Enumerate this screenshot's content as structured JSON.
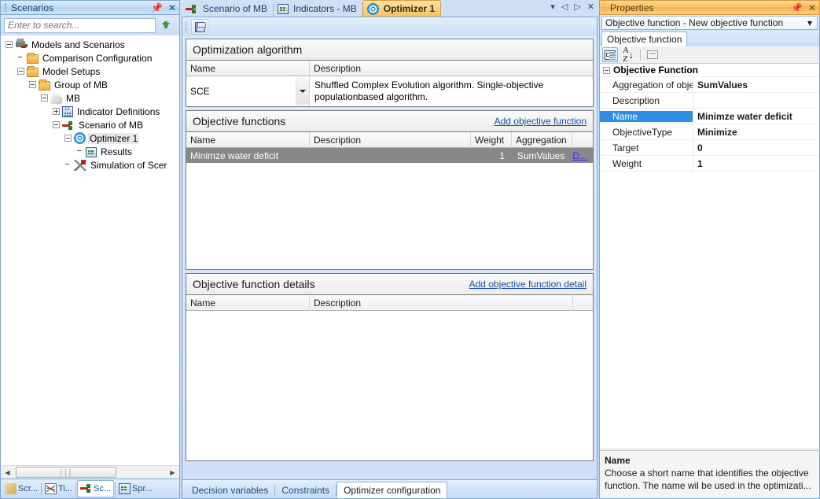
{
  "scenarios": {
    "title": "Scenarios",
    "pin_icon": "pin-icon",
    "close_icon": "close-icon",
    "search": {
      "placeholder": "Enter to search...",
      "value": "",
      "go_icon": "green-down-arrow-icon"
    },
    "tree": [
      {
        "label": "Models and Scenarios",
        "icon": "database-scenario-icon",
        "depth": 0,
        "expander": "minus",
        "selected": false
      },
      {
        "label": "Comparison Configuration",
        "icon": "folder-icon",
        "depth": 1,
        "expander": "none",
        "selected": false
      },
      {
        "label": "Model Setups",
        "icon": "folder-icon",
        "depth": 1,
        "expander": "minus",
        "selected": false
      },
      {
        "label": "Group of MB",
        "icon": "folder-icon",
        "depth": 2,
        "expander": "minus",
        "selected": false
      },
      {
        "label": "MB",
        "icon": "cube-icon",
        "depth": 3,
        "expander": "minus",
        "selected": false
      },
      {
        "label": "Indicator Definitions",
        "icon": "calculator-icon",
        "depth": 4,
        "expander": "plus",
        "selected": false
      },
      {
        "label": "Scenario of MB",
        "icon": "scenario-icon",
        "depth": 4,
        "expander": "minus",
        "selected": false
      },
      {
        "label": "Optimizer 1",
        "icon": "optimizer-icon",
        "depth": 5,
        "expander": "minus",
        "selected": true
      },
      {
        "label": "Results",
        "icon": "results-grid-icon",
        "depth": 6,
        "expander": "none",
        "selected": false
      },
      {
        "label": "Simulation of Scer",
        "icon": "simulation-icon",
        "depth": 5,
        "expander": "none",
        "selected": false
      }
    ],
    "hscroll": {
      "left_arrow": "left-arrow-icon",
      "right_arrow": "right-arrow-icon",
      "thumb_grip": "||||"
    }
  },
  "bottom_left_tabs": [
    {
      "label": "Scr...",
      "icon": "scroll-icon",
      "active": false
    },
    {
      "label": "Ti...",
      "icon": "timeseries-chart-icon",
      "active": false
    },
    {
      "label": "Sc...",
      "icon": "scenario-icon",
      "active": true
    },
    {
      "label": "Spr...",
      "icon": "spreadsheet-icon",
      "active": false
    }
  ],
  "document": {
    "tabs": [
      {
        "label": "Scenario of MB",
        "icon": "scenario-icon",
        "active": false
      },
      {
        "label": "Indicators - MB",
        "icon": "indicators-icon",
        "active": false
      },
      {
        "label": "Optimizer 1",
        "icon": "optimizer-icon",
        "active": true
      }
    ],
    "tab_buttons": {
      "dropdown_icon": "chevron-down-icon",
      "prev_icon": "prev-triangle-icon",
      "next_icon": "next-triangle-icon",
      "close_icon": "close-icon"
    },
    "toolbar": {
      "save_icon": "save-icon"
    },
    "algorithm_section": {
      "title": "Optimization algorithm",
      "columns": [
        "Name",
        "Description"
      ],
      "row": {
        "name": "SCE",
        "description": "Shuffled Complex Evolution algorithm. Single-objective populationbased algorithm.",
        "dropdown_icon": "combo-caret-down-icon"
      }
    },
    "objective_functions_section": {
      "title": "Objective functions",
      "add_link": "Add objective function",
      "columns": [
        "Name",
        "Description",
        "Weight",
        "Aggregation",
        ""
      ],
      "rows": [
        {
          "name": "Minimze water deficit",
          "description": "",
          "weight": "1",
          "aggregation": "SumValues",
          "action_link": "D...",
          "selected": true
        }
      ]
    },
    "details_section": {
      "title": "Objective function details",
      "add_link": "Add objective function detail",
      "columns": [
        "Name",
        "Description",
        ""
      ],
      "rows": []
    },
    "bottom_tabs": [
      {
        "label": "Decision variables",
        "active": false
      },
      {
        "label": "Constraints",
        "active": false
      },
      {
        "label": "Optimizer configuration",
        "active": true
      }
    ]
  },
  "properties": {
    "title": "Properties",
    "pin_icon": "pin-icon",
    "close_icon": "close-icon",
    "object_selector": {
      "value": "Objective function - New objective function",
      "caret_icon": "chevron-down-icon"
    },
    "tabs": [
      {
        "label": "Objective function",
        "active": true
      }
    ],
    "toolbar": [
      {
        "name": "categorized-button",
        "icon": "categorized-icon",
        "pressed": true
      },
      {
        "name": "alphabetical-button",
        "icon": "sort-az-icon",
        "pressed": false
      },
      {
        "name": "property-pages-button",
        "icon": "property-pages-icon",
        "pressed": false
      }
    ],
    "grid": {
      "group": "Objective Function",
      "rows": [
        {
          "name": "Aggregation of obje",
          "value": "SumValues",
          "selected": false
        },
        {
          "name": "Description",
          "value": "",
          "selected": false
        },
        {
          "name": "Name",
          "value": "Minimze water deficit",
          "selected": true
        },
        {
          "name": "ObjectiveType",
          "value": "Minimize",
          "selected": false
        },
        {
          "name": "Target",
          "value": "0",
          "selected": false
        },
        {
          "name": "Weight",
          "value": "1",
          "selected": false
        }
      ]
    },
    "description": {
      "title": "Name",
      "text": "Choose a short name that identifies the objective function. The name wil be used in the optimizati..."
    }
  },
  "colors": {
    "accent_orange": "#f5b44b",
    "panel_blue": "#7ea7d4",
    "selection_blue": "#2f8de4",
    "row_selected_gray": "#888888",
    "link_blue": "#1a4fa8"
  }
}
